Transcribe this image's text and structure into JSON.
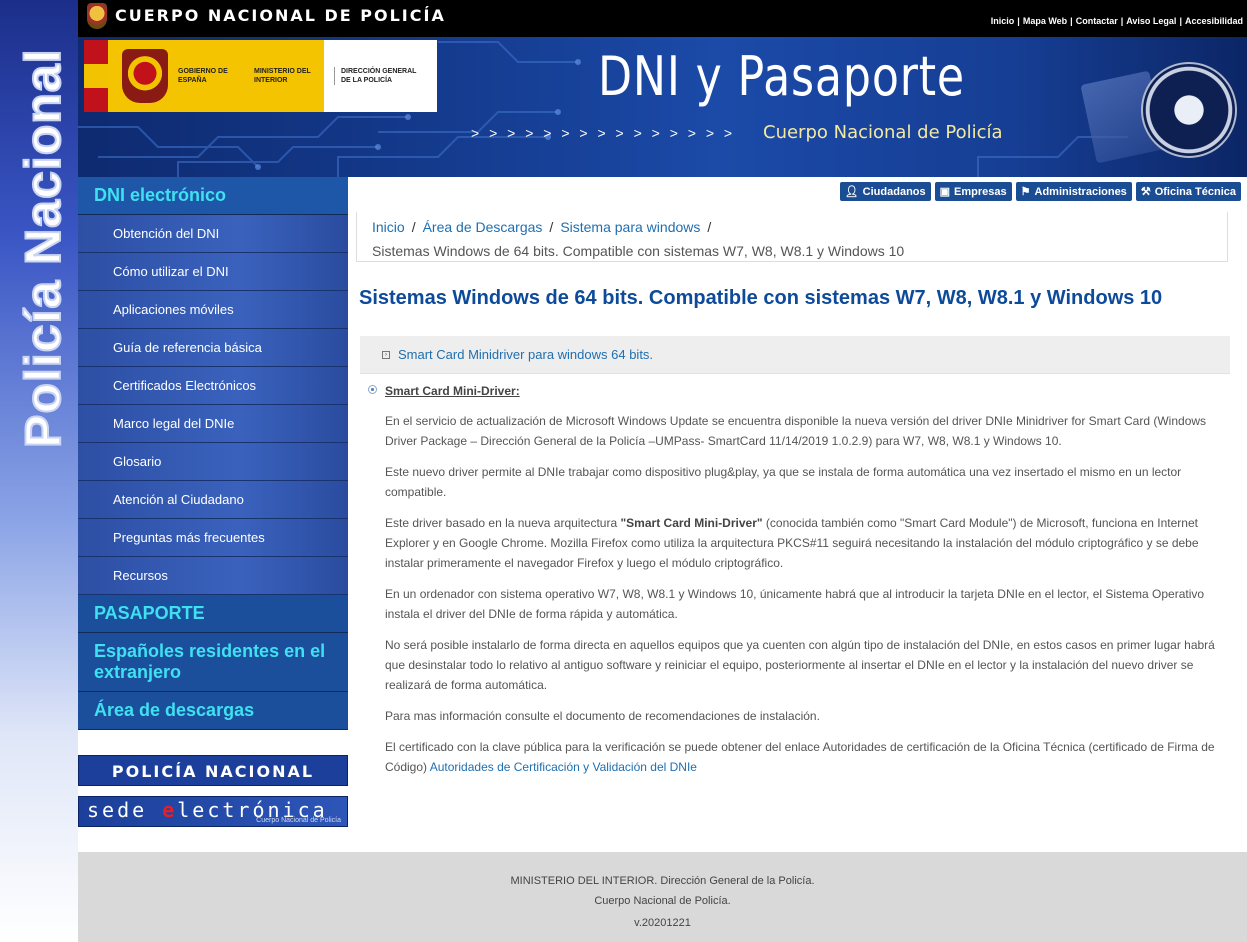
{
  "side_brand": {
    "text": "Policía Nacional"
  },
  "topbar": {
    "brand": "CUERPO NACIONAL DE POLICÍA",
    "links": [
      "Inicio",
      "Mapa Web",
      "Contactar",
      "Aviso Legal",
      "Accesibilidad"
    ],
    "separator": "|"
  },
  "banner": {
    "gov_1": "GOBIERNO DE ESPAÑA",
    "gov_2": "MINISTERIO DEL INTERIOR",
    "gov_3": "DIRECCIÓN GENERAL DE LA POLICÍA",
    "title": "DNI y Pasaporte",
    "arrows": "> > > > > > > > > > > > > > >",
    "subtitle": "Cuerpo Nacional de Policía"
  },
  "nav": {
    "dni_header": "DNI electrónico",
    "dni_items": [
      "Obtención del DNI",
      "Cómo utilizar el DNI",
      "Aplicaciones móviles",
      "Guía de referencia básica",
      "Certificados Electrónicos",
      "Marco legal del DNIe",
      "Glosario",
      "Atención al Ciudadano",
      "Preguntas más frecuentes",
      "Recursos"
    ],
    "pasaporte": "PASAPORTE",
    "residentes": "Españoles residentes en el extranjero",
    "descargas": "Área de descargas"
  },
  "ext_banners": {
    "policia": "POLICÍA NACIONAL",
    "sede_pre": "sede ",
    "sede_e": "e",
    "sede_post": "lectrónica",
    "sede_sub": "Cuerpo Nacional de Policía"
  },
  "role_buttons": [
    {
      "label": "Ciudadanos",
      "icon": "user-icon"
    },
    {
      "label": "Empresas",
      "icon": "briefcase-icon"
    },
    {
      "label": "Administraciones",
      "icon": "flag-icon"
    },
    {
      "label": "Oficina Técnica",
      "icon": "wrench-icon"
    }
  ],
  "breadcrumb": {
    "items": [
      "Inicio",
      "Área de Descargas",
      "Sistema para windows"
    ],
    "current": "Sistemas Windows de 64 bits. Compatible con sistemas W7, W8, W8.1 y Windows 10",
    "sep": "/"
  },
  "page_title": "Sistemas Windows de 64 bits. Compatible con sistemas W7, W8, W8.1 y Windows 10",
  "anchor_link": "Smart Card Minidriver para windows 64 bits.",
  "content": {
    "section_title": "Smart Card Mini-Driver:",
    "p1": "En el servicio de actualización de Microsoft Windows Update se encuentra disponible la nueva versión del driver DNIe Minidriver for Smart Card (Windows Driver Package – Dirección General de la Policía –UMPass- SmartCard 11/14/2019 1.0.2.9) para W7, W8, W8.1 y Windows 10.",
    "p2": "Este nuevo driver permite al DNIe trabajar como dispositivo plug&play, ya que se instala de forma automática una vez insertado el mismo en un lector compatible.",
    "p3_pre": "Este driver basado en la nueva arquitectura ",
    "p3_bold": "\"Smart Card Mini-Driver\"",
    "p3_post": " (conocida también como \"Smart Card Module\") de Microsoft, funciona en Internet Explorer y en Google Chrome. Mozilla Firefox como utiliza la arquitectura PKCS#11 seguirá necesitando la instalación del módulo criptográfico y se debe instalar primeramente el navegador Firefox y luego el módulo criptográfico.",
    "p4": "En un ordenador con sistema operativo W7, W8, W8.1 y Windows 10, únicamente habrá que al introducir la tarjeta DNIe en el lector, el Sistema Operativo instala el driver del DNIe de forma rápida y automática.",
    "p5": "No será posible instalarlo de forma directa en aquellos equipos que ya cuenten con algún tipo de instalación del DNIe, en estos casos en primer lugar habrá que desinstalar todo lo relativo al antiguo software y reiniciar el equipo, posteriormente al insertar el DNIe en el lector y la instalación del nuevo driver se realizará de forma automática.",
    "p6": "Para mas información consulte el documento de recomendaciones de instalación.",
    "p7_pre": "El certificado con la clave pública para la verificación se puede obtener del enlace Autoridades de certificación de la Oficina Técnica (certificado de Firma de Código) ",
    "p7_link": "Autoridades de Certificación y Validación del DNIe"
  },
  "footer": {
    "line1": "MINISTERIO DEL INTERIOR. Dirección General de la Policía.",
    "line2": "Cuerpo Nacional de Policía.",
    "version": "v.20201221"
  },
  "colors": {
    "nav_header": "#1f57a8",
    "nav_header_text": "#3fe0f0",
    "link": "#1f6fb0",
    "title": "#0d4a99",
    "role_button": "#1b4d95",
    "footer_bg": "#d9d9d9"
  }
}
